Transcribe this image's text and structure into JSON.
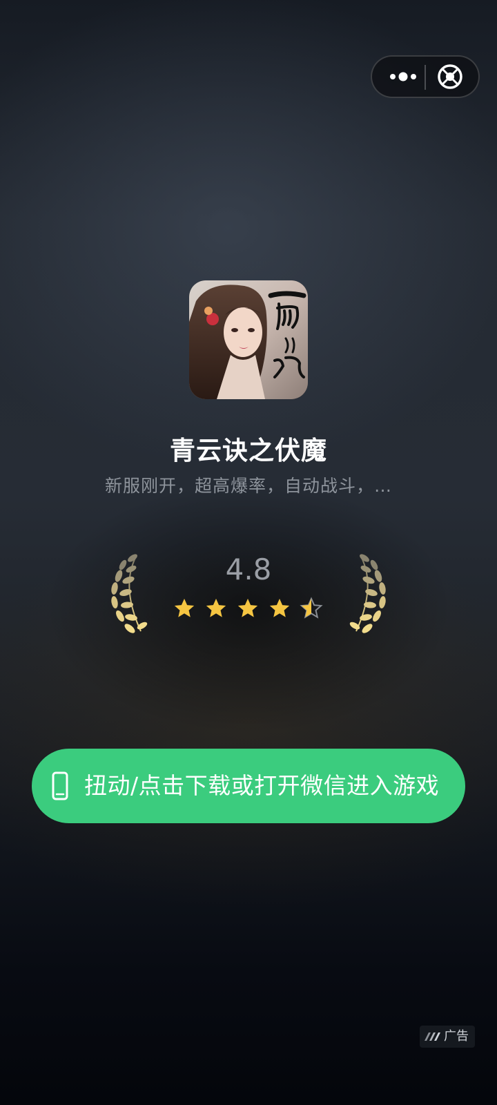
{
  "capsule": {
    "more_icon": "more-dots-icon",
    "close_icon": "close-circle-icon"
  },
  "app": {
    "icon": "game-app-icon",
    "title": "青云诀之伏魔",
    "description": "新服刚开，超高爆率，自动战斗，…"
  },
  "rating": {
    "score": "4.8",
    "stars_value": 4.5,
    "stars_max": 5,
    "star_color": "#f5c542",
    "laurel_color": "#d8c48c"
  },
  "cta": {
    "label": "扭动/点击下载或打开微信进入游戏",
    "icon": "phone-icon",
    "color": "#3bcc7e"
  },
  "ad": {
    "logo_icon": "ad-logo-icon",
    "label": "广告"
  }
}
